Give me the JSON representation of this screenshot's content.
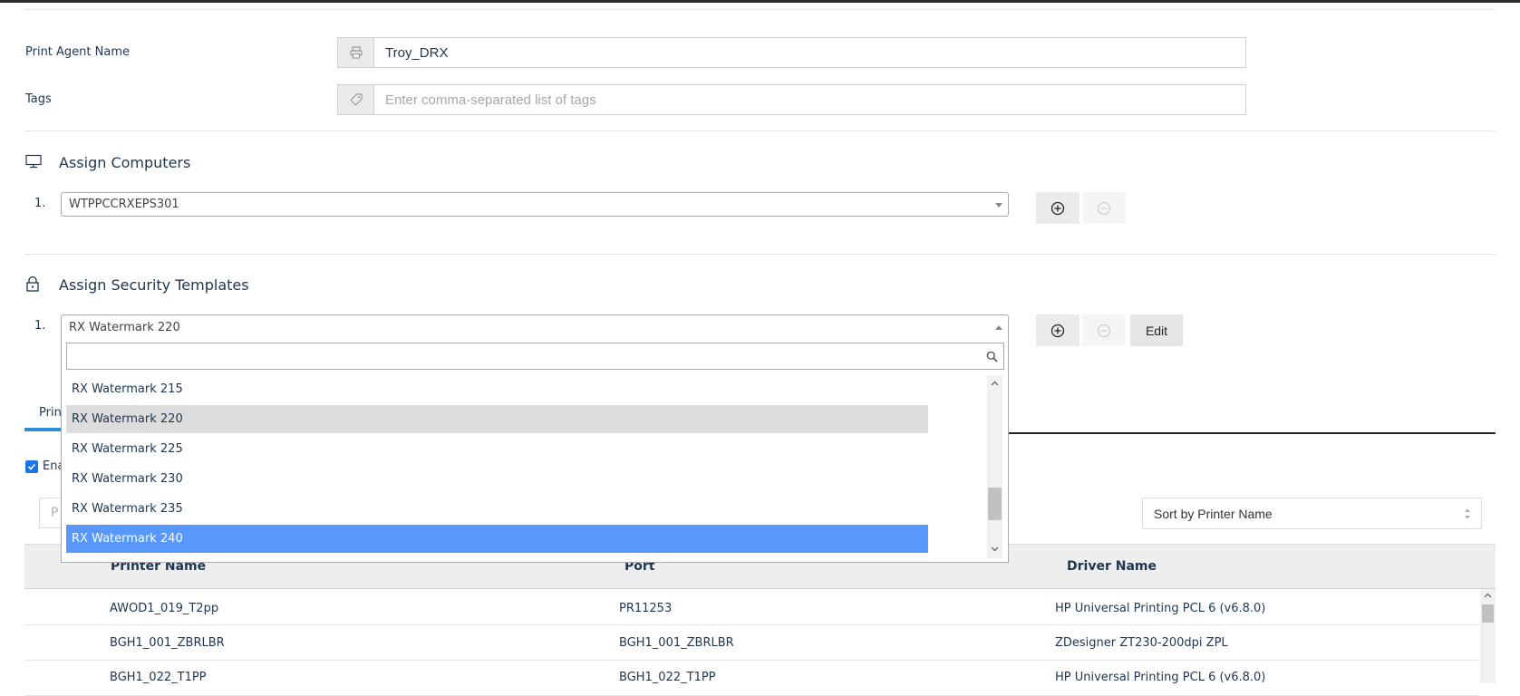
{
  "form": {
    "print_agent_label": "Print Agent Name",
    "print_agent_value": "Troy_DRX",
    "tags_label": "Tags",
    "tags_placeholder": "Enter comma-separated list of tags"
  },
  "computers": {
    "title": "Assign Computers",
    "items": [
      {
        "num": "1.",
        "value": "WTPPCCRXEPS301"
      }
    ]
  },
  "security": {
    "title": "Assign Security Templates",
    "items": [
      {
        "num": "1.",
        "value": "RX Watermark 220"
      }
    ],
    "edit_label": "Edit",
    "dropdown": {
      "search_value": "",
      "options": [
        "RX Watermark 215",
        "RX Watermark 220",
        "RX Watermark 225",
        "RX Watermark 230",
        "RX Watermark 235",
        "RX Watermark 240"
      ],
      "selected_option": "RX Watermark 220",
      "highlighted_option": "RX Watermark 240"
    }
  },
  "tabs": {
    "partial_label": "Prin"
  },
  "enable": {
    "partial_label": "Ena",
    "checked": true
  },
  "filter": {
    "partial_placeholder": "P"
  },
  "sort": {
    "value": "Sort by Printer Name"
  },
  "table": {
    "columns": [
      "Printer Name",
      "Port",
      "Driver Name"
    ],
    "rows": [
      {
        "name": "AWOD1_019_T2pp",
        "port": "PR11253",
        "driver": "HP Universal Printing PCL 6 (v6.8.0)"
      },
      {
        "name": "BGH1_001_ZBRLBR",
        "port": "BGH1_001_ZBRLBR",
        "driver": "ZDesigner ZT230-200dpi ZPL"
      },
      {
        "name": "BGH1_022_T1PP",
        "port": "BGH1_022_T1PP",
        "driver": "HP Universal Printing PCL 6 (v6.8.0)"
      }
    ]
  },
  "colors": {
    "accent": "#2e8fd6",
    "highlight": "#5897fb",
    "text": "#1f3550"
  }
}
